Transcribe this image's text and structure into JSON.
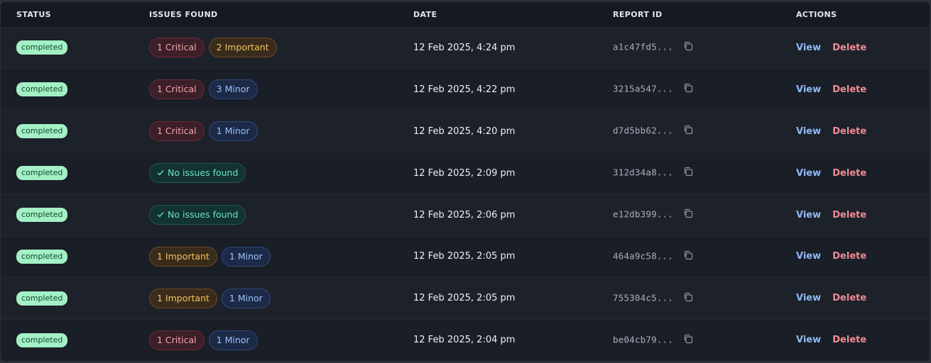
{
  "headers": {
    "status": "STATUS",
    "issues": "ISSUES FOUND",
    "date": "DATE",
    "report_id": "REPORT ID",
    "actions": "ACTIONS"
  },
  "actions": {
    "view": "View",
    "delete": "Delete"
  },
  "rows": [
    {
      "status": "completed",
      "issues": [
        {
          "type": "critical",
          "label": "1 Critical"
        },
        {
          "type": "important",
          "label": "2 Important"
        }
      ],
      "date": "12 Feb 2025, 4:24 pm",
      "report_id": "a1c47fd5..."
    },
    {
      "status": "completed",
      "issues": [
        {
          "type": "critical",
          "label": "1 Critical"
        },
        {
          "type": "minor",
          "label": "3 Minor"
        }
      ],
      "date": "12 Feb 2025, 4:22 pm",
      "report_id": "3215a547..."
    },
    {
      "status": "completed",
      "issues": [
        {
          "type": "critical",
          "label": "1 Critical"
        },
        {
          "type": "minor",
          "label": "1 Minor"
        }
      ],
      "date": "12 Feb 2025, 4:20 pm",
      "report_id": "d7d5bb62..."
    },
    {
      "status": "completed",
      "issues": [
        {
          "type": "none",
          "label": "No issues found"
        }
      ],
      "date": "12 Feb 2025, 2:09 pm",
      "report_id": "312d34a8..."
    },
    {
      "status": "completed",
      "issues": [
        {
          "type": "none",
          "label": "No issues found"
        }
      ],
      "date": "12 Feb 2025, 2:06 pm",
      "report_id": "e12db399..."
    },
    {
      "status": "completed",
      "issues": [
        {
          "type": "important",
          "label": "1 Important"
        },
        {
          "type": "minor",
          "label": "1 Minor"
        }
      ],
      "date": "12 Feb 2025, 2:05 pm",
      "report_id": "464a9c58..."
    },
    {
      "status": "completed",
      "issues": [
        {
          "type": "important",
          "label": "1 Important"
        },
        {
          "type": "minor",
          "label": "1 Minor"
        }
      ],
      "date": "12 Feb 2025, 2:05 pm",
      "report_id": "755304c5..."
    },
    {
      "status": "completed",
      "issues": [
        {
          "type": "critical",
          "label": "1 Critical"
        },
        {
          "type": "minor",
          "label": "1 Minor"
        }
      ],
      "date": "12 Feb 2025, 2:04 pm",
      "report_id": "be04cb79..."
    }
  ],
  "icons": {
    "copy": "copy-icon",
    "check": "check-icon"
  },
  "colors": {
    "status_bg": "#a4f0c5",
    "critical": "#f2a6ae",
    "important": "#f2c25b",
    "minor": "#9cc1f8",
    "none": "#6ee3c3",
    "view": "#8cbaf5",
    "delete": "#ef8b93"
  }
}
